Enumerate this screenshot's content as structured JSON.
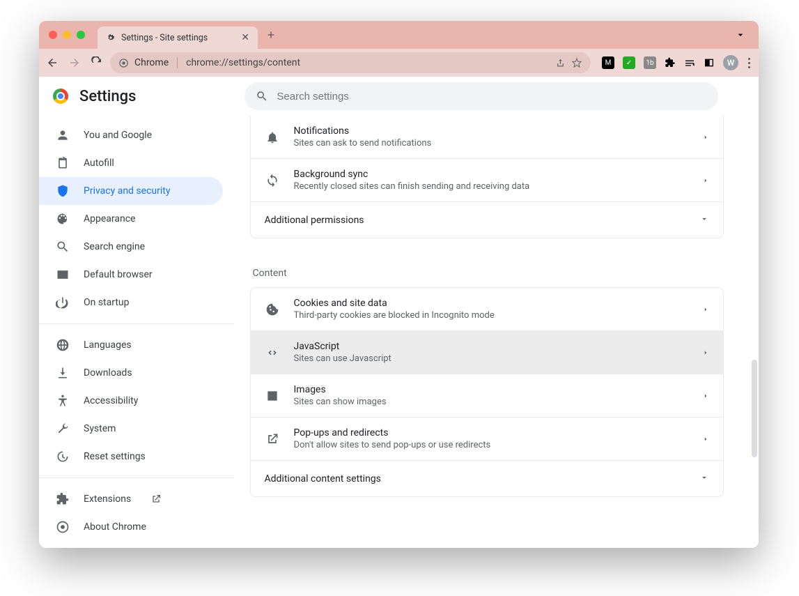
{
  "browser": {
    "tab_title": "Settings - Site settings",
    "omnibox_label": "Chrome",
    "omnibox_url": "chrome://settings/content",
    "avatar_letter": "W"
  },
  "header": {
    "title": "Settings",
    "search_placeholder": "Search settings"
  },
  "sidebar": {
    "items": [
      {
        "label": "You and Google"
      },
      {
        "label": "Autofill"
      },
      {
        "label": "Privacy and security"
      },
      {
        "label": "Appearance"
      },
      {
        "label": "Search engine"
      },
      {
        "label": "Default browser"
      },
      {
        "label": "On startup"
      }
    ],
    "items2": [
      {
        "label": "Languages"
      },
      {
        "label": "Downloads"
      },
      {
        "label": "Accessibility"
      },
      {
        "label": "System"
      },
      {
        "label": "Reset settings"
      }
    ],
    "items3": [
      {
        "label": "Extensions"
      },
      {
        "label": "About Chrome"
      }
    ]
  },
  "permissions": {
    "rows": [
      {
        "title": "Notifications",
        "sub": "Sites can ask to send notifications"
      },
      {
        "title": "Background sync",
        "sub": "Recently closed sites can finish sending and receiving data"
      }
    ],
    "expand_label": "Additional permissions"
  },
  "content": {
    "section_label": "Content",
    "rows": [
      {
        "title": "Cookies and site data",
        "sub": "Third-party cookies are blocked in Incognito mode"
      },
      {
        "title": "JavaScript",
        "sub": "Sites can use Javascript"
      },
      {
        "title": "Images",
        "sub": "Sites can show images"
      },
      {
        "title": "Pop-ups and redirects",
        "sub": "Don't allow sites to send pop-ups or use redirects"
      }
    ],
    "expand_label": "Additional content settings"
  }
}
